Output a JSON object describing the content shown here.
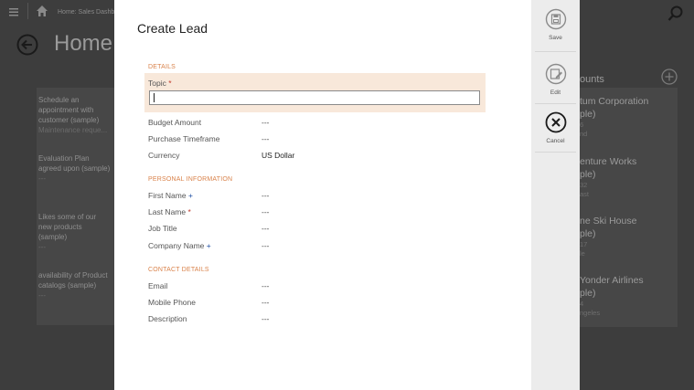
{
  "background": {
    "breadcrumb": "Home: Sales Dashbo",
    "page_title": "Home",
    "activities": [
      {
        "title": "Schedule an appointment with customer (sample)",
        "sub": "Maintenance reque..."
      },
      {
        "title": "Evaluation Plan agreed upon (sample)",
        "sub": "---"
      },
      {
        "title": "Likes some of our new products (sample)",
        "sub": "---"
      },
      {
        "title": "availability of Product catalogs (sample)",
        "sub": "---"
      }
    ],
    "accounts_header": "ounts",
    "accounts": [
      {
        "line1": "tum Corporation",
        "line2": "ple)",
        "line3": "6",
        "line4": "nd"
      },
      {
        "line1": "enture Works",
        "line2": "ple)",
        "line3": "32",
        "line4": "ast"
      },
      {
        "line1": "ne Ski House",
        "line2": "ple)",
        "line3": "17",
        "line4": "le"
      },
      {
        "line1": "Yonder Airlines",
        "line2": "ple)",
        "line3": "4",
        "line4": "ngeles"
      }
    ]
  },
  "dialog": {
    "title": "Create Lead",
    "sections": {
      "details": "DETAILS",
      "personal": "PERSONAL INFORMATION",
      "contact": "CONTACT DETAILS"
    },
    "topic": {
      "label": "Topic",
      "value": ""
    },
    "fields": {
      "budget": {
        "label": "Budget Amount",
        "value": "---"
      },
      "timeframe": {
        "label": "Purchase Timeframe",
        "value": "---"
      },
      "currency": {
        "label": "Currency",
        "value": "US Dollar"
      },
      "first_name": {
        "label": "First Name",
        "value": "---"
      },
      "last_name": {
        "label": "Last Name",
        "value": "---"
      },
      "job_title": {
        "label": "Job Title",
        "value": "---"
      },
      "company": {
        "label": "Company Name",
        "value": "---"
      },
      "email": {
        "label": "Email",
        "value": "---"
      },
      "mobile": {
        "label": "Mobile Phone",
        "value": "---"
      },
      "description": {
        "label": "Description",
        "value": "---"
      }
    },
    "required_mark": "*",
    "recommended_mark": "+"
  },
  "commands": {
    "save": "Save",
    "edit": "Edit",
    "cancel": "Cancel"
  },
  "colors": {
    "section_header": "#d9824a",
    "topic_highlight": "#f8e8da",
    "overlay_background": "#3d3d3d"
  }
}
